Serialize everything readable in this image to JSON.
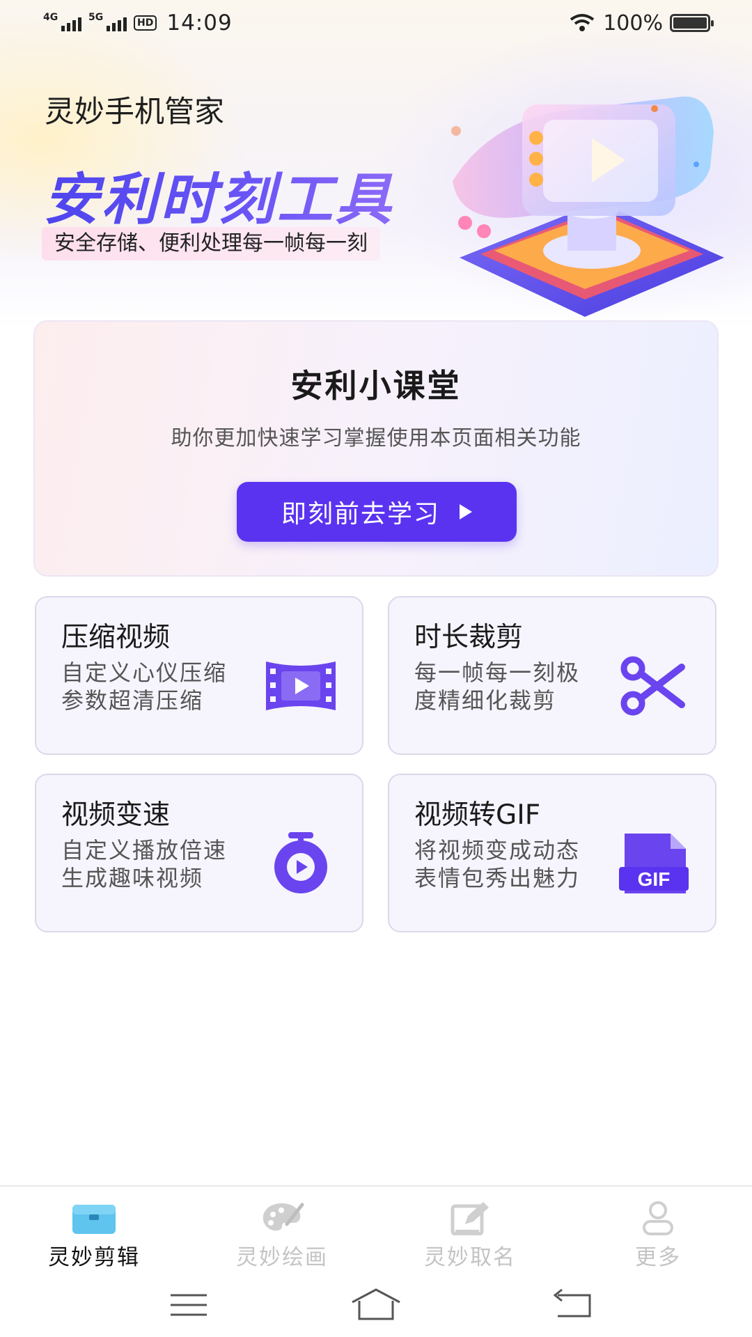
{
  "status_bar": {
    "net1": "4G",
    "net2": "5G",
    "hd": "HD",
    "time": "14:09",
    "battery": "100%"
  },
  "header": {
    "app_title": "灵妙手机管家",
    "headline": "安利时刻工具",
    "subtitle": "安全存储、便利处理每一帧每一刻"
  },
  "classroom": {
    "title": "安利小课堂",
    "description": "助你更加快速学习掌握使用本页面相关功能",
    "button_label": "即刻前去学习"
  },
  "features": [
    {
      "title": "压缩视频",
      "description": "自定义心仪压缩 参数超清压缩",
      "icon": "film-play-icon"
    },
    {
      "title": "时长裁剪",
      "description": "每一帧每一刻极度精细化裁剪",
      "icon": "scissors-icon"
    },
    {
      "title": "视频变速",
      "description": "自定义播放倍速生成趣味视频",
      "icon": "stopwatch-play-icon"
    },
    {
      "title": "视频转GIF",
      "description": "将视频变成动态表情包秀出魅力",
      "icon": "gif-file-icon",
      "icon_text": "GIF"
    }
  ],
  "bottom_nav": {
    "items": [
      {
        "label": "灵妙剪辑",
        "active": true,
        "icon": "toolbox-icon"
      },
      {
        "label": "灵妙绘画",
        "active": false,
        "icon": "palette-icon"
      },
      {
        "label": "灵妙取名",
        "active": false,
        "icon": "edit-icon"
      },
      {
        "label": "更多",
        "active": false,
        "icon": "user-icon"
      }
    ]
  },
  "colors": {
    "accent": "#5a33f0",
    "icon_purple": "#6a44ee",
    "active_nav_icon": "#5fc4ee"
  }
}
